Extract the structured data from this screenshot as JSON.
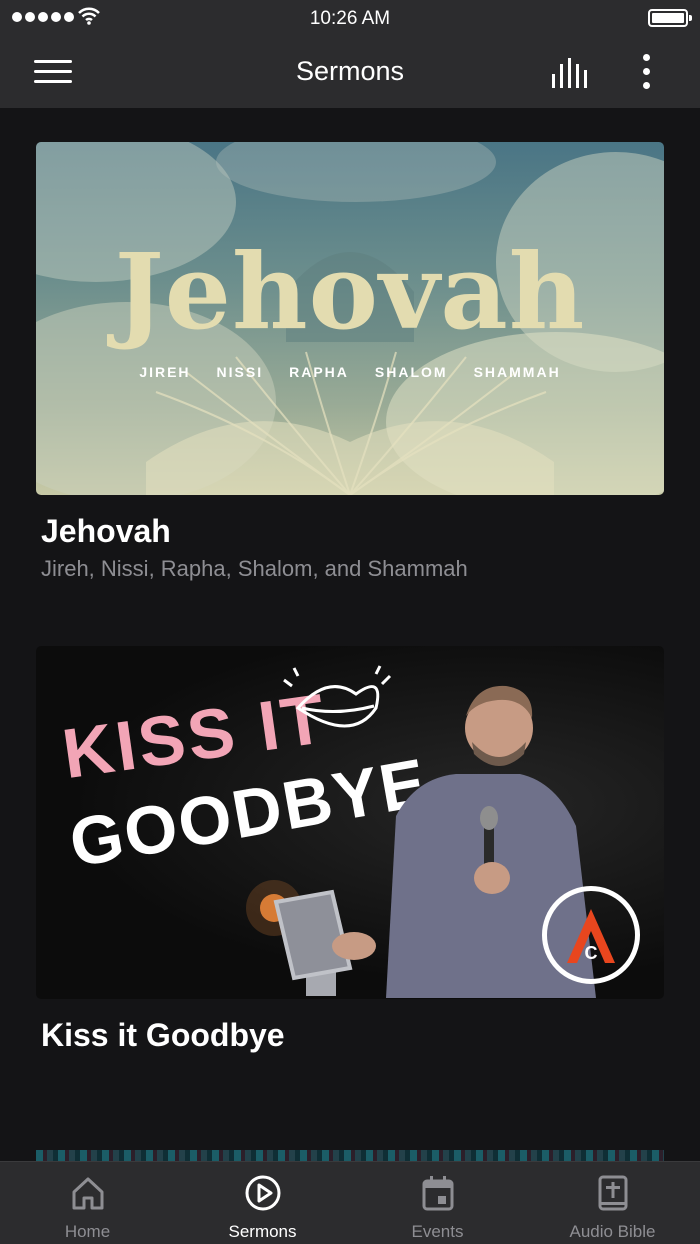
{
  "status_bar": {
    "time": "10:26 AM",
    "icons": [
      "signal-dots-icon",
      "wifi-icon",
      "battery-icon"
    ]
  },
  "header": {
    "title": "Sermons",
    "icons": [
      "hamburger-menu-icon",
      "audio-bars-icon",
      "more-vertical-icon"
    ]
  },
  "sermons": [
    {
      "title": "Jehovah",
      "subtitle": "Jireh, Nissi, Rapha, Shalom, and Shammah",
      "artwork": {
        "headline": "Jehovah",
        "names": [
          "JIREH",
          "NISSI",
          "RAPHA",
          "SHALOM",
          "SHAMMAH"
        ]
      }
    },
    {
      "title": "Kiss it Goodbye",
      "subtitle": "",
      "artwork": {
        "line1": "KISS IT",
        "line2": "GOODBYE",
        "badge_letter": "C"
      }
    }
  ],
  "tabs": [
    {
      "label": "Home",
      "icon": "home-icon",
      "active": false
    },
    {
      "label": "Sermons",
      "icon": "play-circle-icon",
      "active": true
    },
    {
      "label": "Events",
      "icon": "calendar-icon",
      "active": false
    },
    {
      "label": "Audio Bible",
      "icon": "bible-icon",
      "active": false
    }
  ],
  "colors": {
    "background": "#141416",
    "bars": "#2c2c2e",
    "tab_active": "#ffffff",
    "tab_inactive": "#8e8e93",
    "subtitle": "#8e8e93",
    "kiss_pink": "#f2a5b6",
    "badge_orange": "#e8461e"
  }
}
